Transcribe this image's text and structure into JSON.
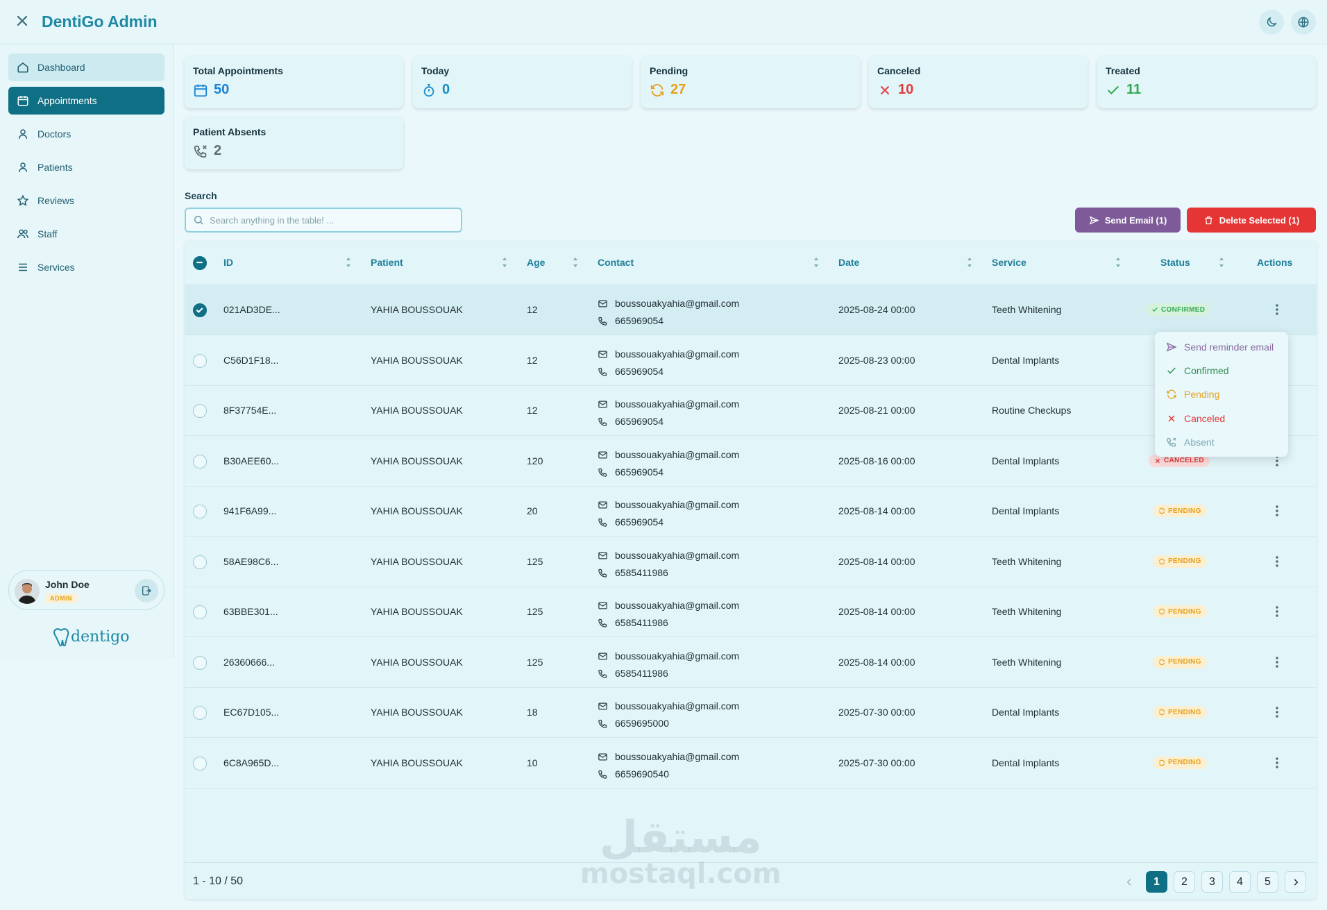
{
  "header": {
    "title": "DentiGo Admin"
  },
  "sidebar": {
    "items": [
      {
        "label": "Dashboard",
        "icon": "home-icon"
      },
      {
        "label": "Appointments",
        "icon": "calendar-icon"
      },
      {
        "label": "Doctors",
        "icon": "user-icon"
      },
      {
        "label": "Patients",
        "icon": "user-icon"
      },
      {
        "label": "Reviews",
        "icon": "star-icon"
      },
      {
        "label": "Staff",
        "icon": "users-icon"
      },
      {
        "label": "Services",
        "icon": "list-icon"
      }
    ],
    "active_item": "Appointments",
    "user": {
      "name": "John Doe",
      "role": "ADMIN"
    },
    "brand": "dentigo"
  },
  "stats": [
    {
      "title": "Total Appointments",
      "value": "50",
      "icon": "calendar-icon",
      "color": "#1b84d6"
    },
    {
      "title": "Today",
      "value": "0",
      "icon": "stopwatch-icon",
      "color": "#1b8fc4"
    },
    {
      "title": "Pending",
      "value": "27",
      "icon": "refresh-icon",
      "color": "#e6a01b"
    },
    {
      "title": "Canceled",
      "value": "10",
      "icon": "x-icon",
      "color": "#e33b3b"
    },
    {
      "title": "Treated",
      "value": "11",
      "icon": "check-icon",
      "color": "#34a853"
    },
    {
      "title": "Patient Absents",
      "value": "2",
      "icon": "phone-missed-icon",
      "color": "#5f6b70"
    }
  ],
  "search": {
    "label": "Search",
    "placeholder": "Search anything in the table! ...",
    "value": ""
  },
  "actions": {
    "send_email": "Send Email (1)",
    "delete_selected": "Delete Selected (1)"
  },
  "table": {
    "columns": [
      "ID",
      "Patient",
      "Age",
      "Contact",
      "Date",
      "Service",
      "Status",
      "Actions"
    ],
    "rows": [
      {
        "id": "021AD3DE...",
        "patient": "YAHIA BOUSSOUAK",
        "age": "12",
        "email": "boussouakyahia@gmail.com",
        "phone": "665969054",
        "date": "2025-08-24 00:00",
        "service": "Teeth Whitening",
        "status": "CONFIRMED",
        "selected": true
      },
      {
        "id": "C56D1F18...",
        "patient": "YAHIA BOUSSOUAK",
        "age": "12",
        "email": "boussouakyahia@gmail.com",
        "phone": "665969054",
        "date": "2025-08-23 00:00",
        "service": "Dental Implants",
        "status": "",
        "selected": false
      },
      {
        "id": "8F37754E...",
        "patient": "YAHIA BOUSSOUAK",
        "age": "12",
        "email": "boussouakyahia@gmail.com",
        "phone": "665969054",
        "date": "2025-08-21 00:00",
        "service": "Routine Checkups",
        "status": "",
        "selected": false
      },
      {
        "id": "B30AEE60...",
        "patient": "YAHIA BOUSSOUAK",
        "age": "120",
        "email": "boussouakyahia@gmail.com",
        "phone": "665969054",
        "date": "2025-08-16 00:00",
        "service": "Dental Implants",
        "status": "CANCELED",
        "selected": false
      },
      {
        "id": "941F6A99...",
        "patient": "YAHIA BOUSSOUAK",
        "age": "20",
        "email": "boussouakyahia@gmail.com",
        "phone": "665969054",
        "date": "2025-08-14 00:00",
        "service": "Dental Implants",
        "status": "PENDING",
        "selected": false
      },
      {
        "id": "58AE98C6...",
        "patient": "YAHIA BOUSSOUAK",
        "age": "125",
        "email": "boussouakyahia@gmail.com",
        "phone": "6585411986",
        "date": "2025-08-14 00:00",
        "service": "Teeth Whitening",
        "status": "PENDING",
        "selected": false
      },
      {
        "id": "63BBE301...",
        "patient": "YAHIA BOUSSOUAK",
        "age": "125",
        "email": "boussouakyahia@gmail.com",
        "phone": "6585411986",
        "date": "2025-08-14 00:00",
        "service": "Teeth Whitening",
        "status": "PENDING",
        "selected": false
      },
      {
        "id": "26360666...",
        "patient": "YAHIA BOUSSOUAK",
        "age": "125",
        "email": "boussouakyahia@gmail.com",
        "phone": "6585411986",
        "date": "2025-08-14 00:00",
        "service": "Teeth Whitening",
        "status": "PENDING",
        "selected": false
      },
      {
        "id": "EC67D105...",
        "patient": "YAHIA BOUSSOUAK",
        "age": "18",
        "email": "boussouakyahia@gmail.com",
        "phone": "6659695000",
        "date": "2025-07-30 00:00",
        "service": "Dental Implants",
        "status": "PENDING",
        "selected": false
      },
      {
        "id": "6C8A965D...",
        "patient": "YAHIA BOUSSOUAK",
        "age": "10",
        "email": "boussouakyahia@gmail.com",
        "phone": "6659690540",
        "date": "2025-07-30 00:00",
        "service": "Dental Implants",
        "status": "PENDING",
        "selected": false
      }
    ]
  },
  "status_menu": [
    {
      "label": "Send reminder email",
      "icon": "send-icon",
      "color": "#8c6a9e"
    },
    {
      "label": "Confirmed",
      "icon": "check-icon",
      "color": "#2f8f4e"
    },
    {
      "label": "Pending",
      "icon": "refresh-icon",
      "color": "#e6a01b"
    },
    {
      "label": "Canceled",
      "icon": "x-icon",
      "color": "#e33b3b"
    },
    {
      "label": "Absent",
      "icon": "phone-missed-icon",
      "color": "#7fa9b3"
    }
  ],
  "pagination": {
    "range": "1 - 10 / 50",
    "pages": [
      "1",
      "2",
      "3",
      "4",
      "5"
    ],
    "current": "1"
  },
  "watermark": {
    "arabic": "مستقل",
    "latin": "mostaql.com"
  }
}
